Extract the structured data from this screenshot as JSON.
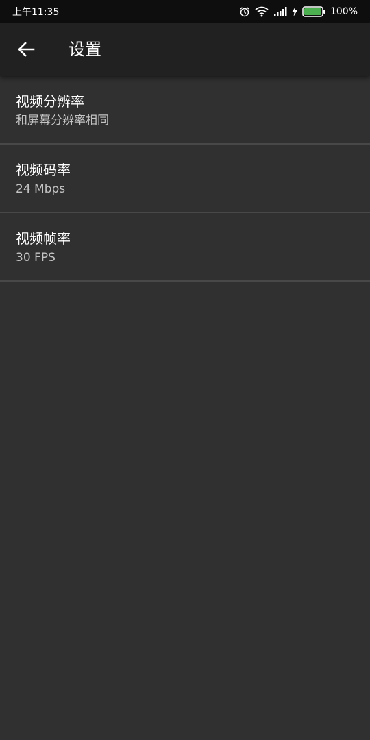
{
  "status_bar": {
    "time": "上午11:35",
    "battery_percent": "100%",
    "icons": [
      "alarm-icon",
      "wifi-icon",
      "signal-icon",
      "charging-icon",
      "battery-icon"
    ],
    "battery_color": "#4caf50"
  },
  "app_bar": {
    "back_icon": "arrow-back-icon",
    "title": "设置"
  },
  "settings": [
    {
      "title": "视频分辨率",
      "value": "和屏幕分辨率相同"
    },
    {
      "title": "视频码率",
      "value": "24 Mbps"
    },
    {
      "title": "视频帧率",
      "value": "30 FPS"
    }
  ],
  "colors": {
    "background": "#303030",
    "app_bar": "#212121",
    "status_bar": "#0e0e0e",
    "divider": "#484848",
    "secondary_text": "#c4c4c4"
  }
}
